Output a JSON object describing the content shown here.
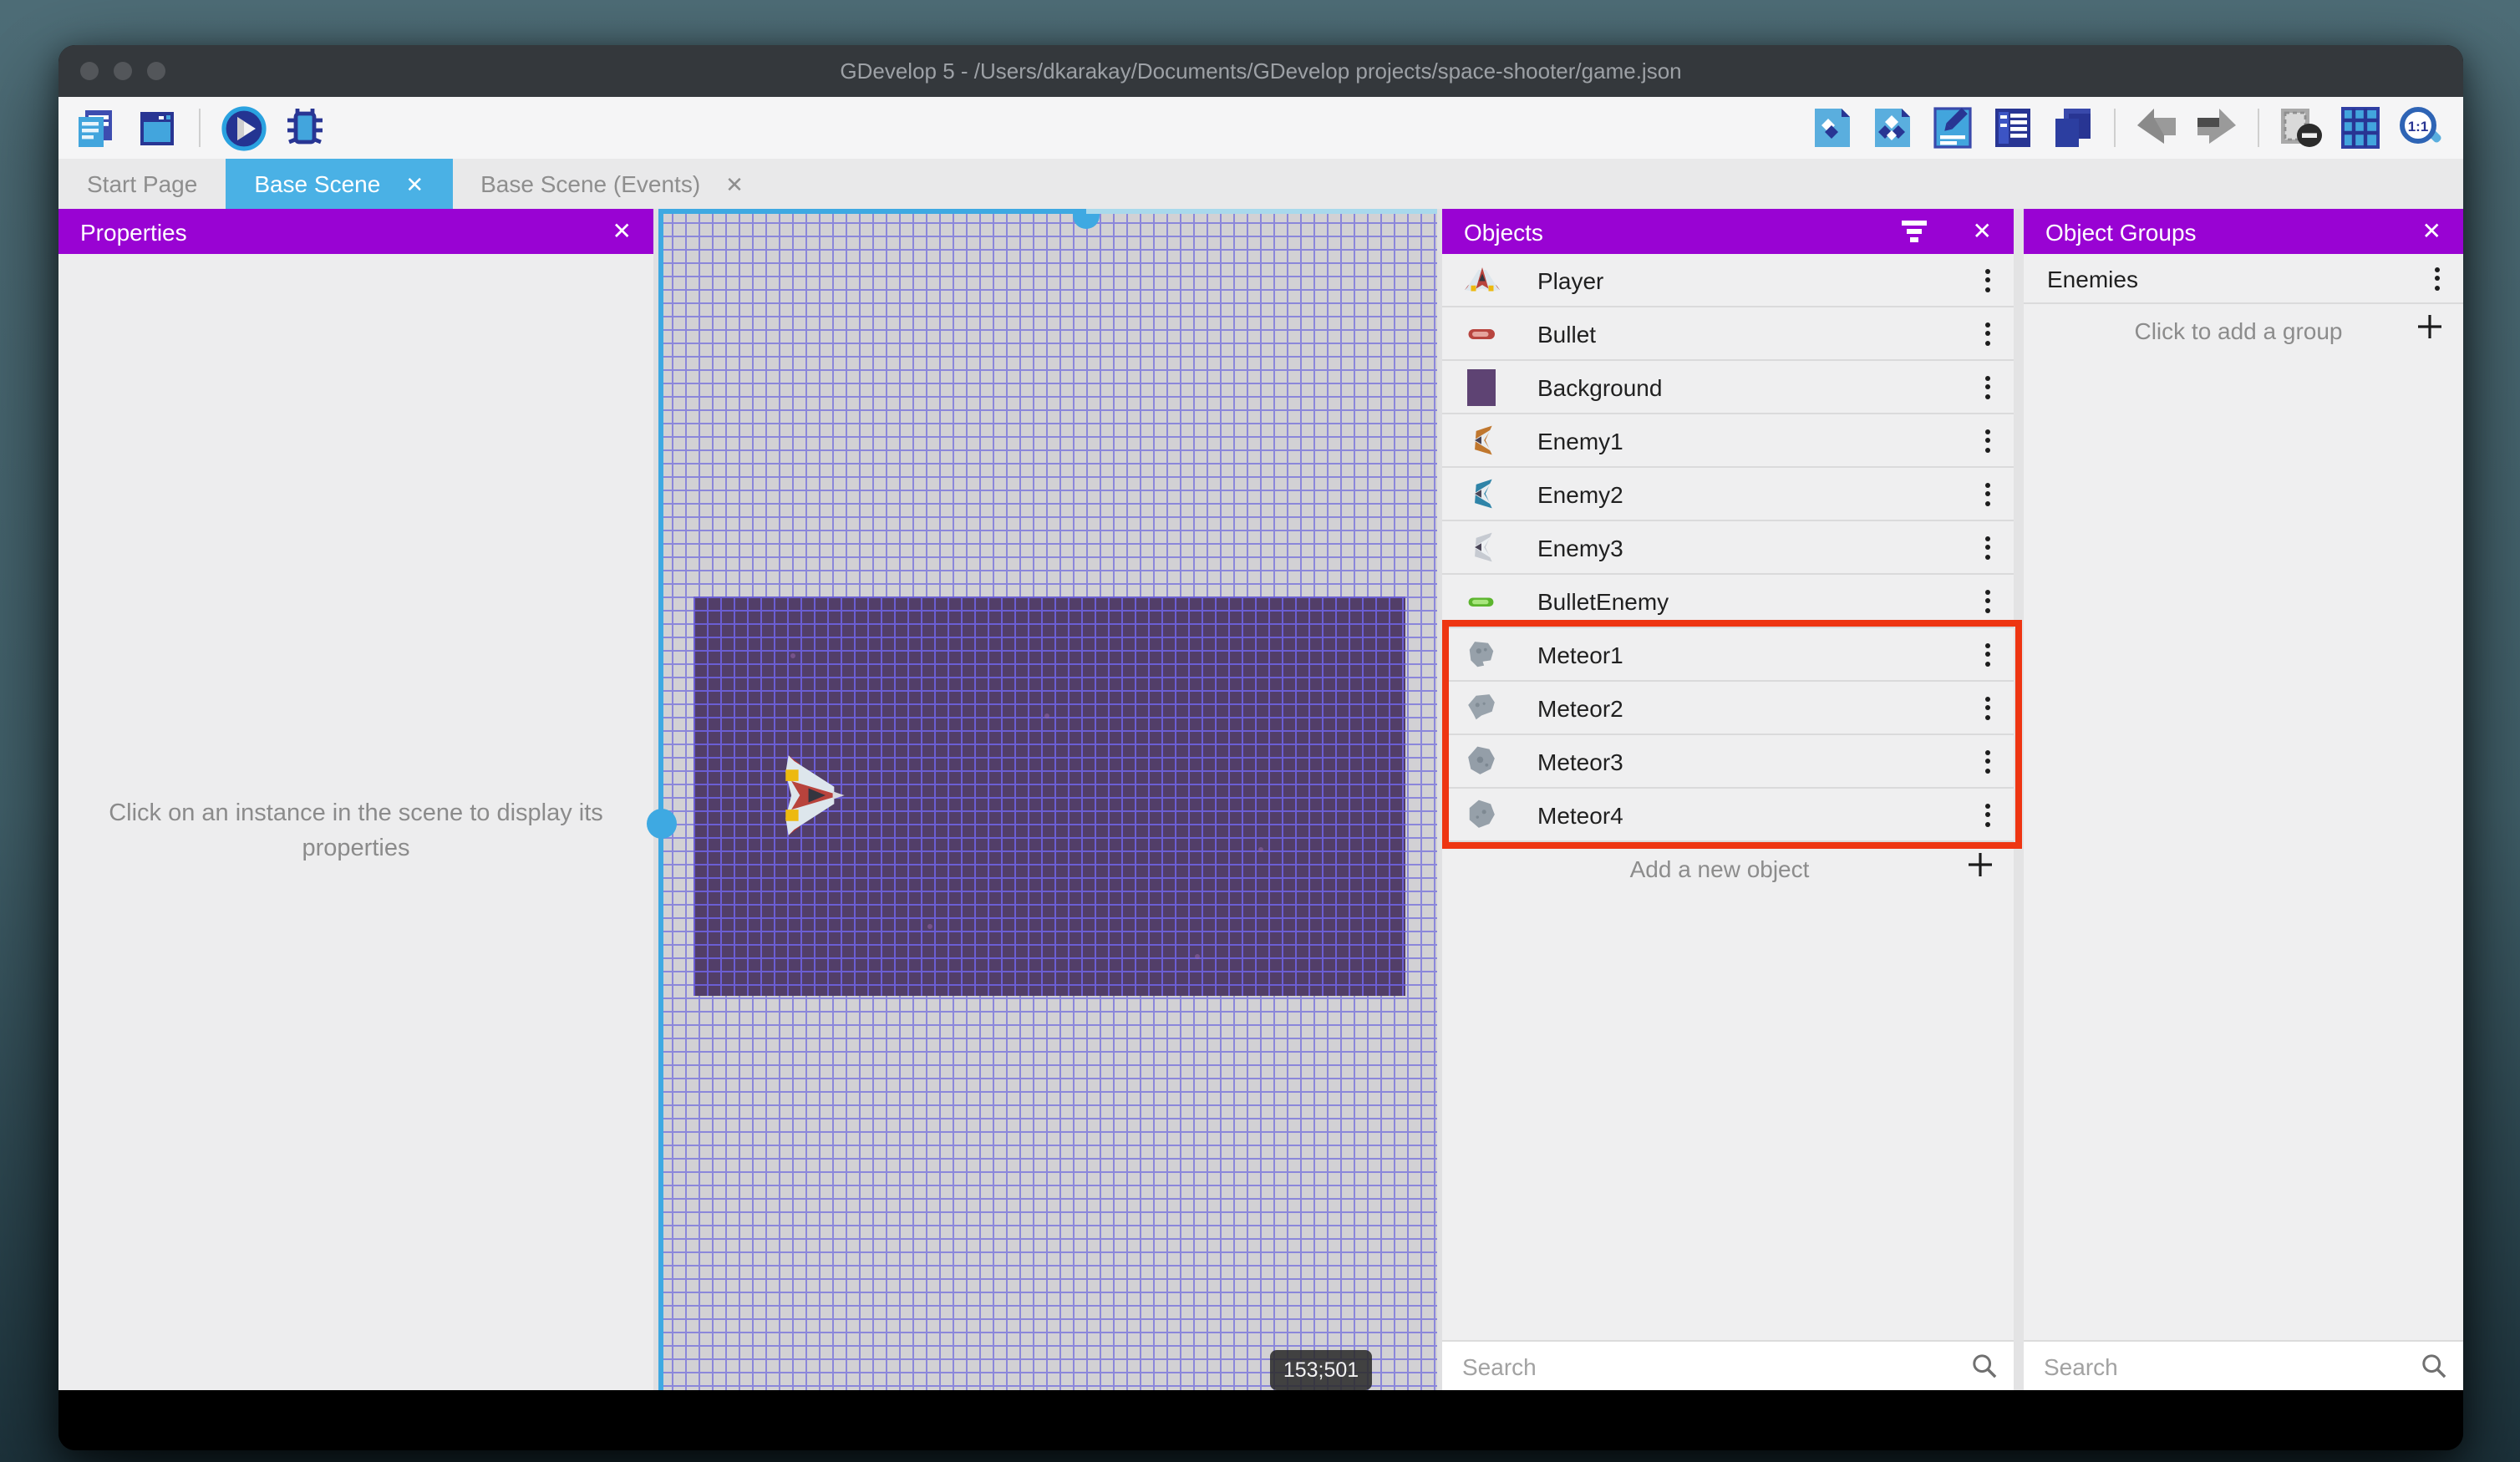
{
  "window": {
    "title": "GDevelop 5 - /Users/dkarakay/Documents/GDevelop projects/space-shooter/game.json"
  },
  "tabs": [
    {
      "label": "Start Page",
      "active": false,
      "closable": false
    },
    {
      "label": "Base Scene",
      "active": true,
      "closable": true,
      "close_glyph": "✕"
    },
    {
      "label": "Base Scene (Events)",
      "active": false,
      "closable": true,
      "close_glyph": "✕"
    }
  ],
  "toolbar": {
    "left_icons": [
      "project-manager",
      "scene-window",
      "play",
      "debug"
    ],
    "right_icons": [
      "objects-panel",
      "object-groups-panel",
      "properties-panel",
      "instances-list",
      "layers",
      "undo",
      "redo",
      "toggle-mask",
      "toggle-grid",
      "zoom-1-1"
    ]
  },
  "panels": {
    "properties": {
      "title": "Properties",
      "close_glyph": "✕",
      "empty_message": "Click on an instance in the scene to display its properties"
    },
    "objects": {
      "title": "Objects",
      "close_glyph": "✕",
      "items": [
        "Player",
        "Bullet",
        "Background",
        "Enemy1",
        "Enemy2",
        "Enemy3",
        "BulletEnemy",
        "Meteor1",
        "Meteor2",
        "Meteor3",
        "Meteor4"
      ],
      "add_label": "Add a new object",
      "search_placeholder": "Search"
    },
    "object_groups": {
      "title": "Object Groups",
      "close_glyph": "✕",
      "groups": [
        "Enemies"
      ],
      "add_label": "Click to add a group",
      "search_placeholder": "Search"
    }
  },
  "canvas": {
    "coordinate_label": "153;501",
    "selected_object": "Background"
  },
  "annotation": {
    "highlighted_rows": [
      "Meteor1",
      "Meteor2",
      "Meteor3",
      "Meteor4"
    ],
    "color": "#ee3512"
  },
  "colors": {
    "panel_header": "#9903d3",
    "active_tab": "#4ab1e5",
    "selection": "#3ea9e2",
    "canvas_bg": "#d2d1d4",
    "canvas_grid": "#8b87da",
    "background_object": "#523e68",
    "titlebar": "#34383c"
  }
}
